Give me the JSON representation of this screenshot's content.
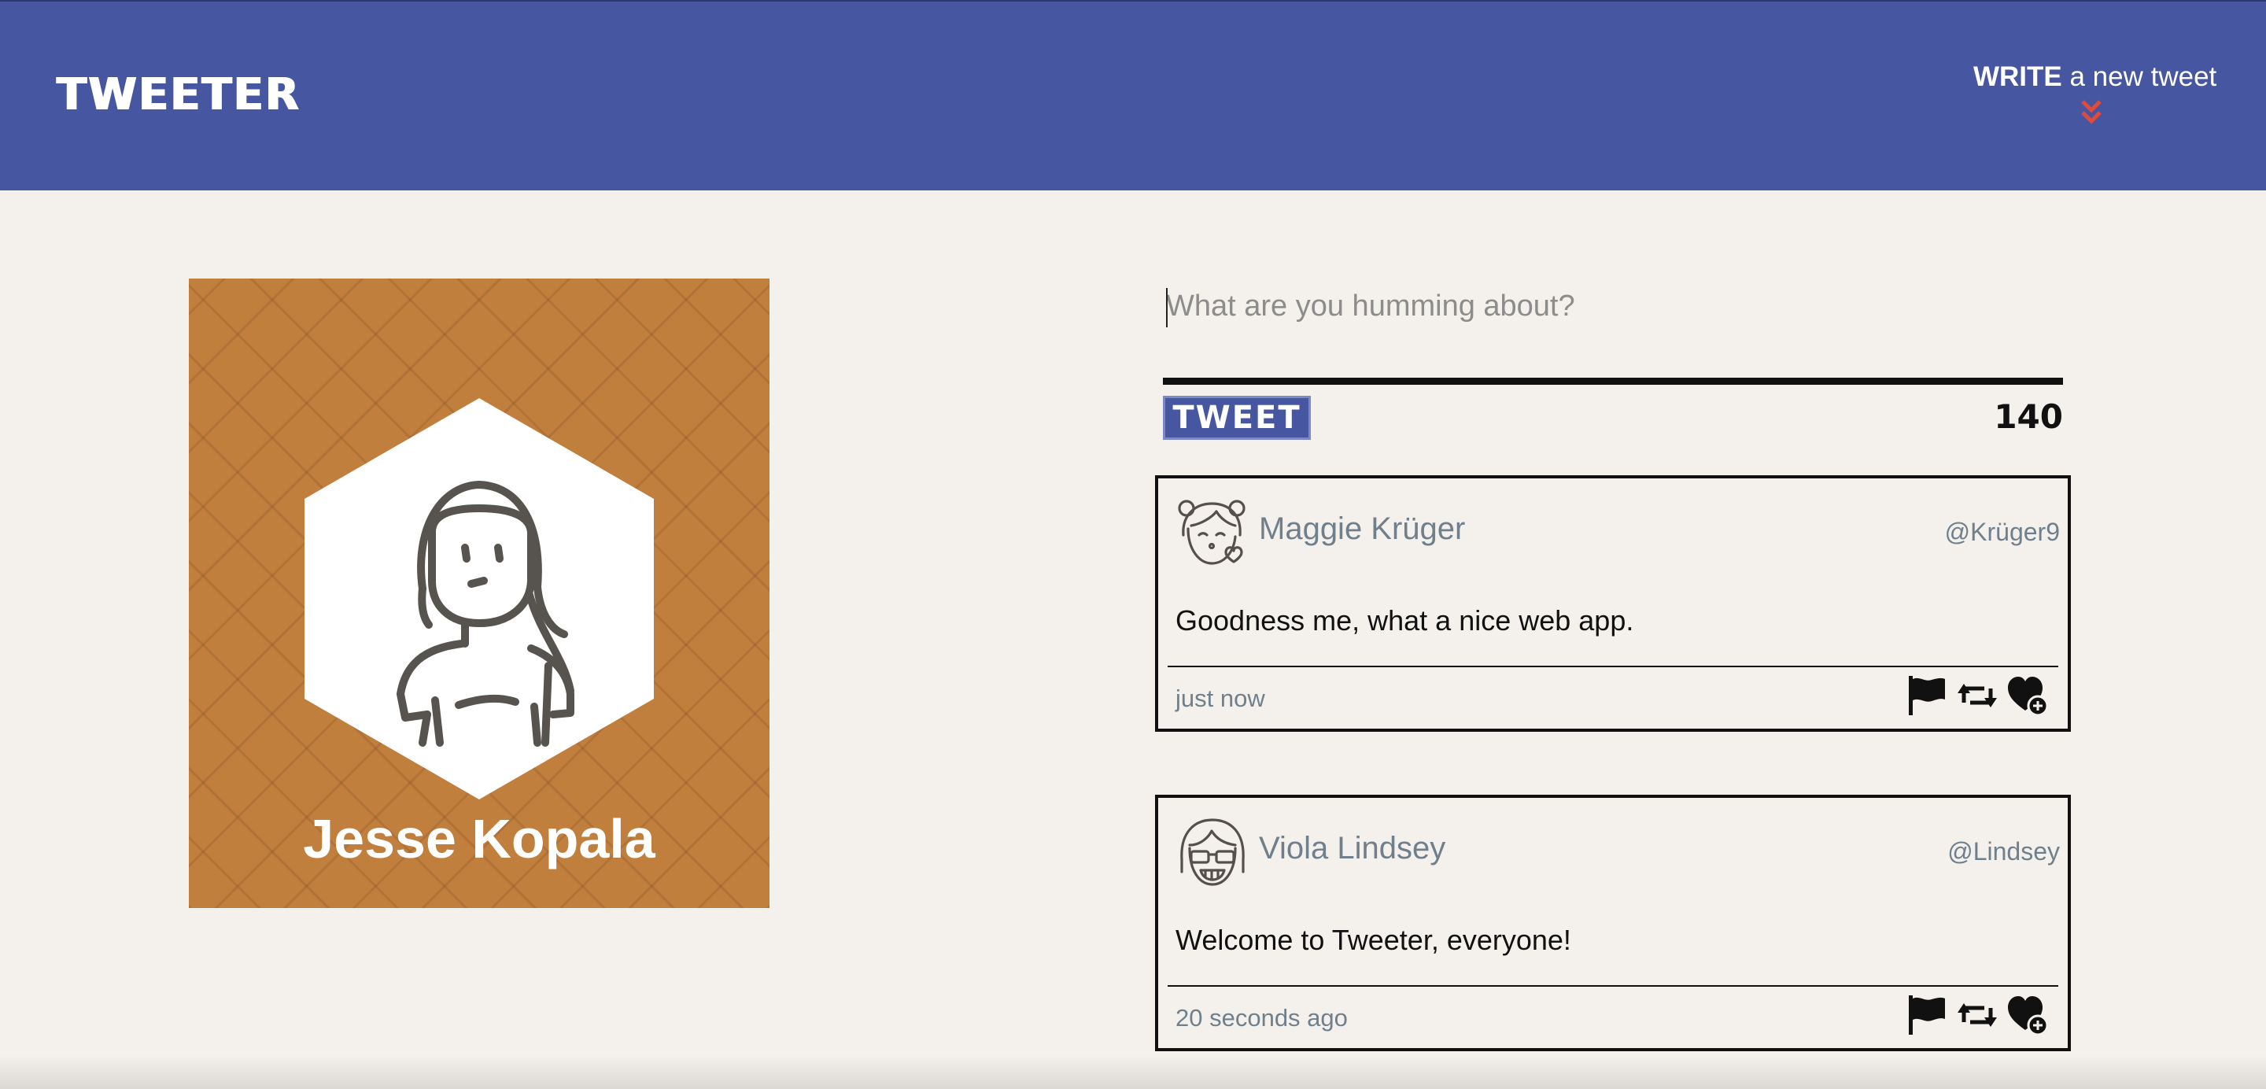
{
  "nav": {
    "brand": "TWEETER",
    "compose_strong": "WRITE",
    "compose_rest": " a new tweet",
    "chevron_icon": "double-chevron-down-icon",
    "chevron_color": "#e04b3c"
  },
  "profile": {
    "name": "Jesse Kopala",
    "background_color": "#c17f3e",
    "avatar_icon": "woman-avatar-icon"
  },
  "composer": {
    "placeholder": "What are you humming about?",
    "submit_label": "TWEET",
    "counter": "140"
  },
  "tweets": [
    {
      "author": "Maggie Krüger",
      "handle": "@Krüger9",
      "content": "Goodness me, what a nice web app.",
      "time": "just now",
      "avatar_icon": "girl-kiss-avatar-icon"
    },
    {
      "author": "Viola Lindsey",
      "handle": "@Lindsey",
      "content": "Welcome to Tweeter, everyone!",
      "time": "20 seconds ago",
      "avatar_icon": "girl-glasses-avatar-icon"
    }
  ],
  "tweet_actions": {
    "flag_icon": "flag-icon",
    "retweet_icon": "retweet-icon",
    "like_icon": "heart-plus-icon"
  },
  "colors": {
    "nav_background": "#4656a0",
    "page_background": "#f4f1ec",
    "muted_text": "#6f7f8c"
  }
}
